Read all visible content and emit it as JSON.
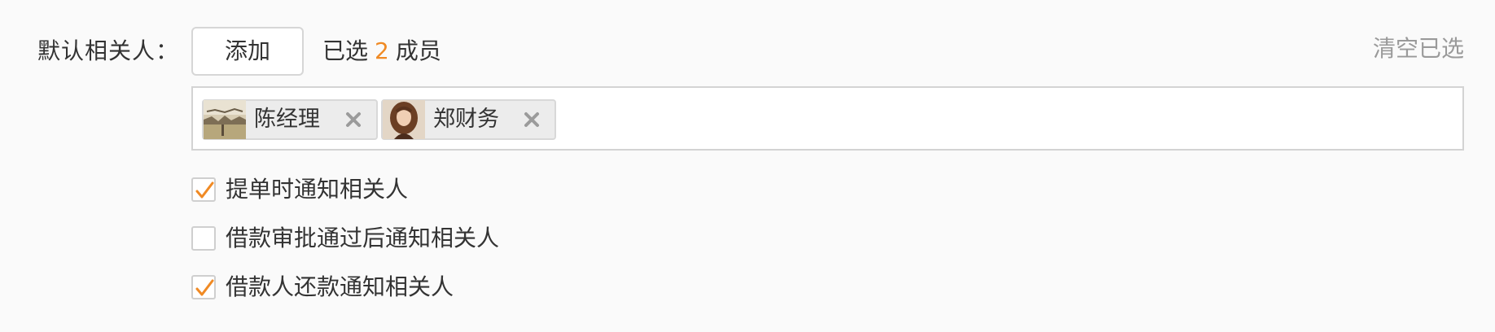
{
  "field": {
    "label": "默认相关人：",
    "add_button_label": "添加",
    "selected_prefix": "已选",
    "selected_count": "2",
    "selected_suffix": "成员",
    "clear_label": "清空已选"
  },
  "selected_people": [
    {
      "name": "陈经理",
      "avatar_icon": "avatar-photo-landscape",
      "remove_icon": "close-icon"
    },
    {
      "name": "郑财务",
      "avatar_icon": "avatar-photo-portrait",
      "remove_icon": "close-icon"
    }
  ],
  "options": [
    {
      "label": "提单时通知相关人",
      "checked": true
    },
    {
      "label": "借款审批通过后通知相关人",
      "checked": false
    },
    {
      "label": "借款人还款通知相关人",
      "checked": true
    }
  ],
  "colors": {
    "accent": "#f08a24",
    "text": "#333333",
    "muted": "#9a9a9a",
    "border": "#d3d3d3",
    "tag_bg": "#ececec"
  }
}
